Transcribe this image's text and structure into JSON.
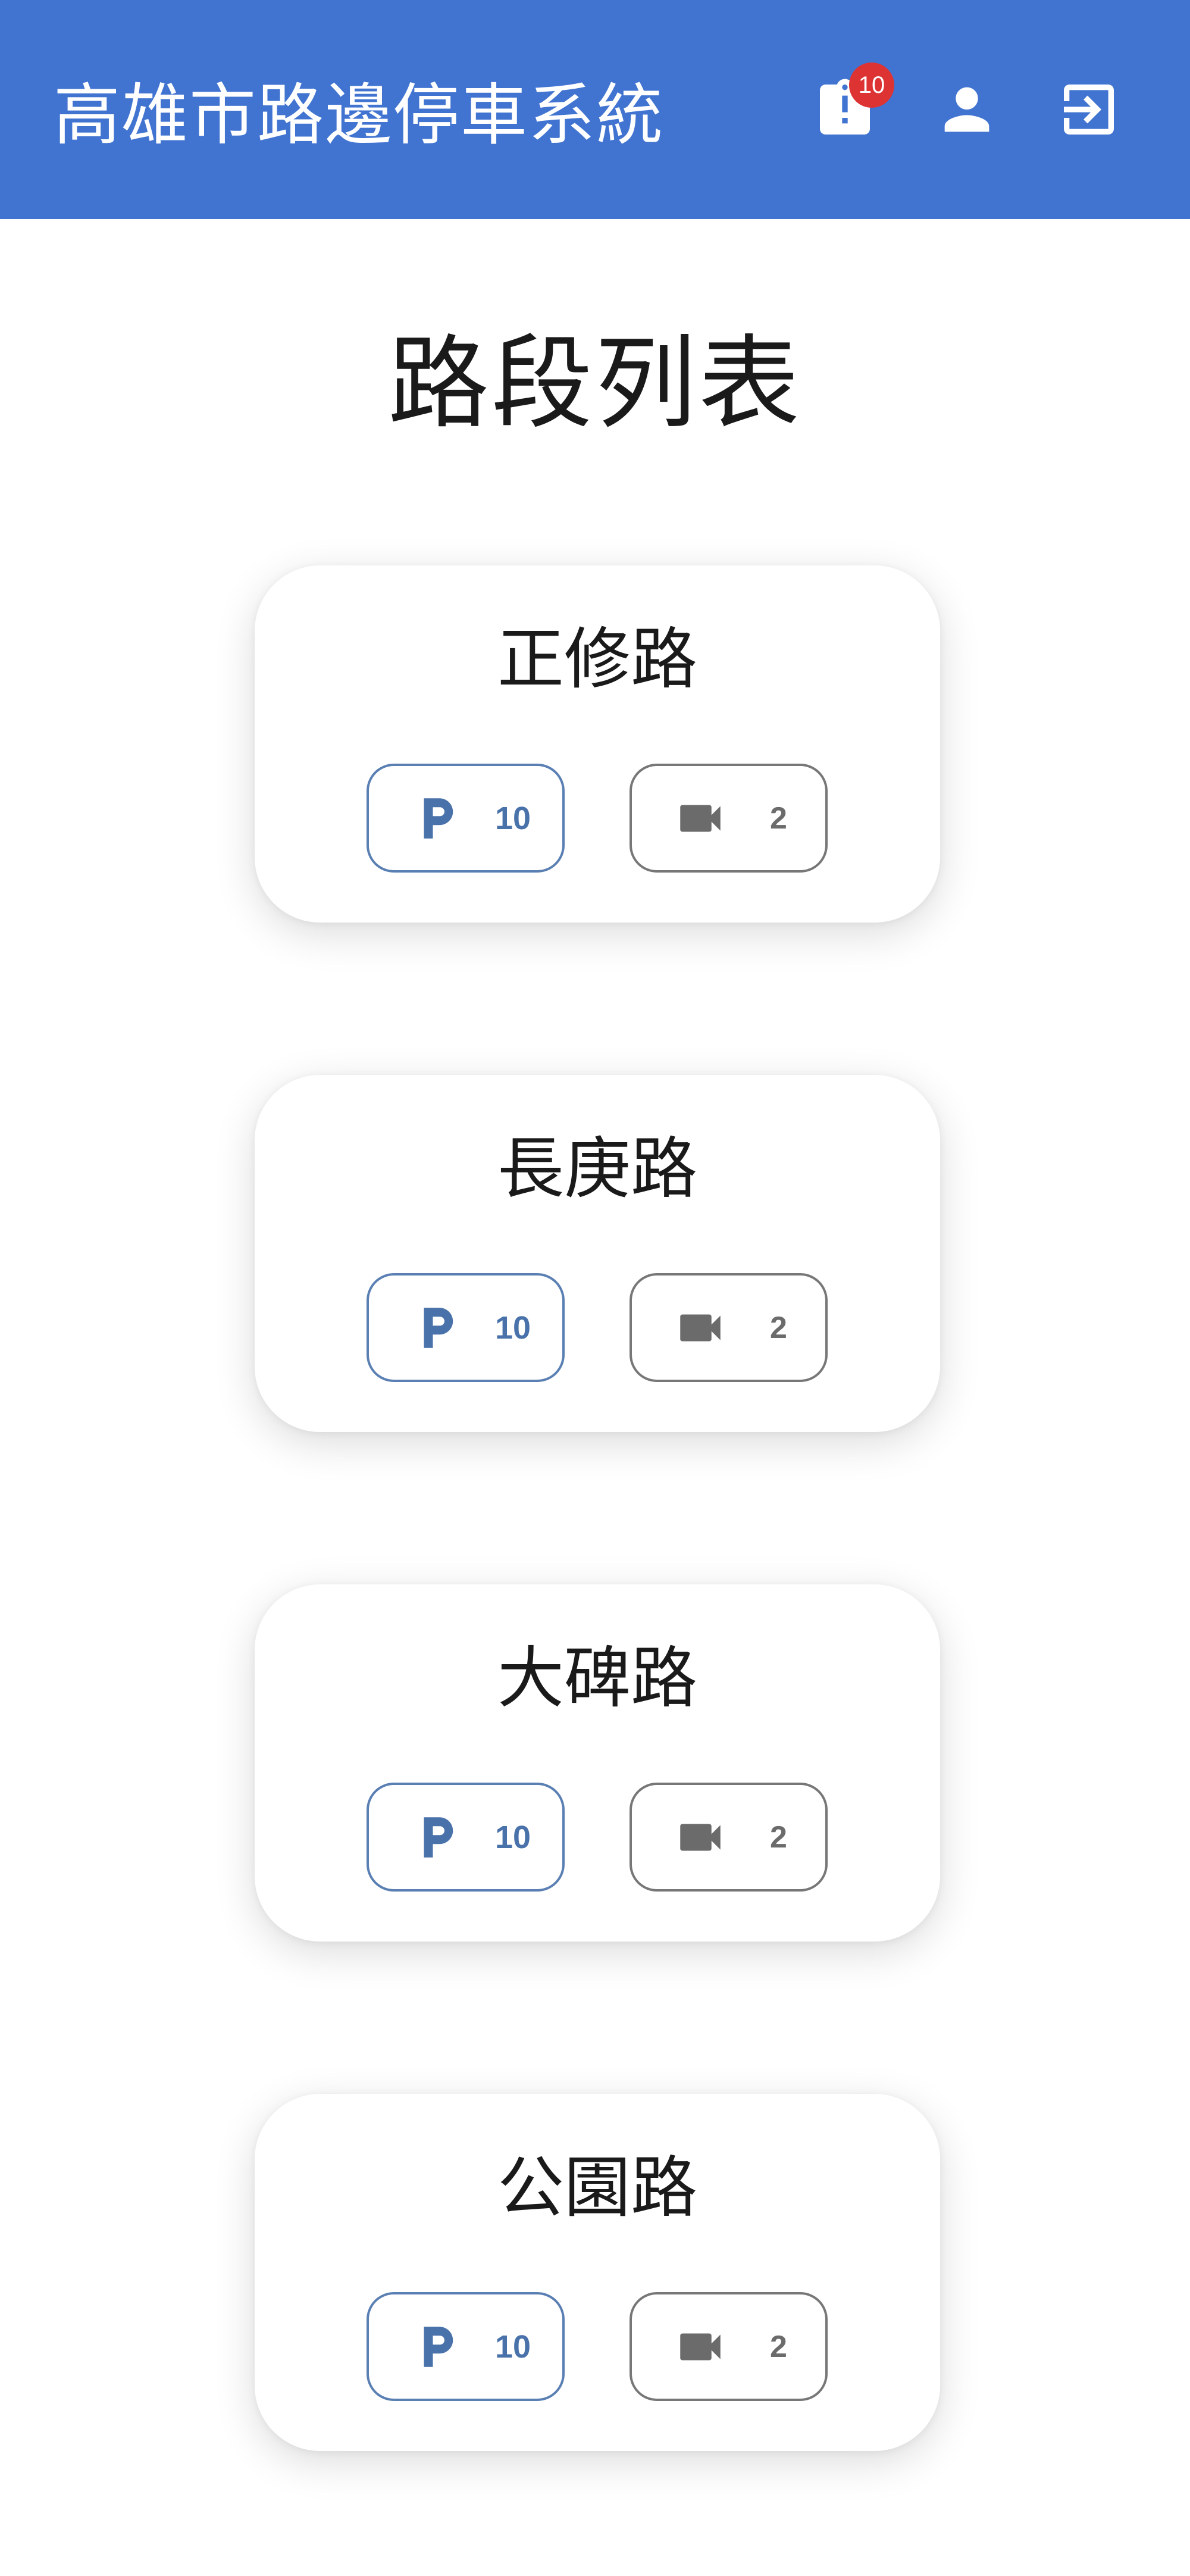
{
  "app": {
    "title": "高雄市路邊停車系統",
    "notification_count": "10",
    "icons": {
      "notifications": "clipboard-alert-icon",
      "account": "person-icon",
      "logout": "logout-icon"
    },
    "colors": {
      "app_bar": "#4174d1",
      "badge": "#dd3333",
      "parking_chip": "#4a72aa",
      "camera_chip": "#6b6b6b"
    }
  },
  "page": {
    "heading": "路段列表"
  },
  "roads": [
    {
      "name": "正修路",
      "parking_count": "10",
      "camera_count": "2"
    },
    {
      "name": "長庚路",
      "parking_count": "10",
      "camera_count": "2"
    },
    {
      "name": "大碑路",
      "parking_count": "10",
      "camera_count": "2"
    },
    {
      "name": "公園路",
      "parking_count": "10",
      "camera_count": "2"
    }
  ],
  "chip_icons": {
    "parking": "parking-icon",
    "camera": "videocam-icon"
  }
}
